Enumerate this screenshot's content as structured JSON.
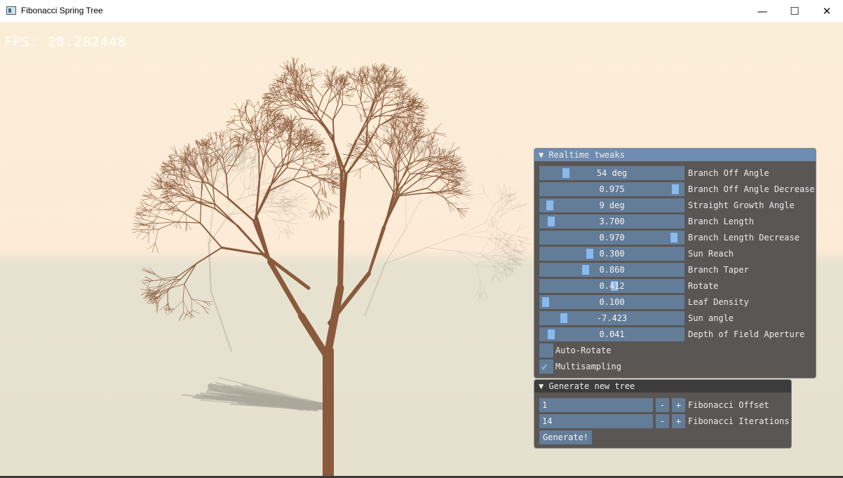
{
  "window": {
    "title": "Fibonacci Spring Tree",
    "minimize_glyph": "—",
    "maximize_glyph": "☐",
    "close_glyph": "✕",
    "icon": "app-window-icon"
  },
  "viewport": {
    "fps_text": "FPS: 28.282448",
    "sky_color": "#fbeed8",
    "ground_color": "#e6e1cf",
    "trunk_color": "#8a5a3c",
    "shadow_color": "#aba79a"
  },
  "realtime_panel": {
    "title": "▼ Realtime tweaks",
    "header_color": "#6e8cb1",
    "sliders": [
      {
        "value": "54 deg",
        "label": "Branch Off Angle",
        "fill": 0.17
      },
      {
        "value": "0.975",
        "label": "Branch Off Angle Decrease",
        "fill": 0.96
      },
      {
        "value": "9 deg",
        "label": "Straight Growth Angle",
        "fill": 0.05
      },
      {
        "value": "3.700",
        "label": "Branch Length",
        "fill": 0.06
      },
      {
        "value": "0.970",
        "label": "Branch Length Decrease",
        "fill": 0.95
      },
      {
        "value": "0.300",
        "label": "Sun Reach",
        "fill": 0.34
      },
      {
        "value": "0.860",
        "label": "Branch Taper",
        "fill": 0.31
      },
      {
        "value": "0.412",
        "label": "Rotate",
        "fill": 0.52
      },
      {
        "value": "0.100",
        "label": "Leaf Density",
        "fill": 0.02
      },
      {
        "value": "-7.423",
        "label": "Sun angle",
        "fill": 0.15
      },
      {
        "value": "0.041",
        "label": "Depth of Field Aperture",
        "fill": 0.06
      }
    ],
    "checkboxes": [
      {
        "label": "Auto-Rotate",
        "checked": false,
        "mark": ""
      },
      {
        "label": "Multisampling",
        "checked": true,
        "mark": "✔"
      }
    ]
  },
  "generate_panel": {
    "title": "▼ Generate new tree",
    "header_color": "#3c3c3c",
    "inputs": [
      {
        "value": "1",
        "label": "Fibonacci Offset",
        "minus": "-",
        "plus": "+"
      },
      {
        "value": "14",
        "label": "Fibonacci Iterations",
        "minus": "-",
        "plus": "+"
      }
    ],
    "button_label": "Generate!"
  }
}
